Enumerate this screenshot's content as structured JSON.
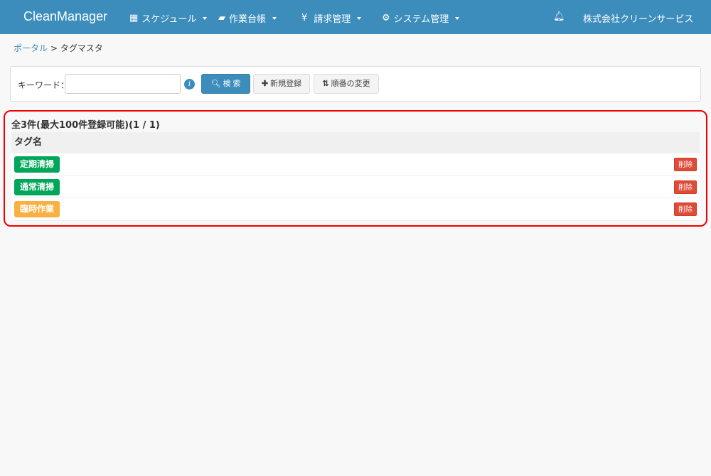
{
  "header": {
    "brand": "CleanManager",
    "menus": [
      {
        "label": "スケジュール",
        "icon": "calendar-icon"
      },
      {
        "label": "作業台帳",
        "icon": "book-icon"
      },
      {
        "label": "請求管理",
        "icon": "yen-icon"
      },
      {
        "label": "システム管理",
        "icon": "gears-icon"
      }
    ],
    "company": "株式会社クリーンサービス"
  },
  "breadcrumb": {
    "portal": "ポータル",
    "sep": ">",
    "current": "タグマスタ"
  },
  "search": {
    "label": "キーワード：",
    "value": "",
    "search_label": "検 索",
    "new_label": "新規登録",
    "order_label": "順番の変更"
  },
  "list": {
    "count": "全3件(最大100件登録可能)(1 / 1)",
    "column": "タグ名",
    "delete_label": "削除",
    "rows": [
      {
        "name": "定期清掃",
        "color": "#00a65a"
      },
      {
        "name": "通常清掃",
        "color": "#00a65a"
      },
      {
        "name": "臨時作業",
        "color": "#f9b040"
      }
    ]
  }
}
